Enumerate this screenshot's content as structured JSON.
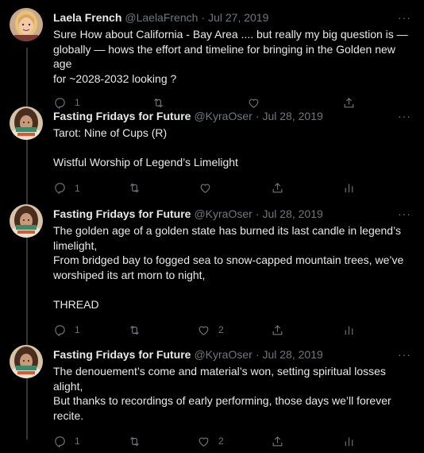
{
  "tweets": [
    {
      "name": "Laela French",
      "handle": "@LaelaFrench",
      "separator": "·",
      "date": "Jul 27, 2019",
      "text": "Sure How about California - Bay Area .... but really my big question is —\nglobally — hows the effort and timeline for bringing in the Golden new age\nfor ~2028-2032 looking ?",
      "replies": "1",
      "retweets": "",
      "likes": "",
      "show_analytics": false
    },
    {
      "name": "Fasting Fridays for Future",
      "handle": "@KyraOser",
      "separator": "·",
      "date": "Jul 28, 2019",
      "text": "Tarot: Nine of Cups (R)\n\nWistful Worship of Legend’s Limelight",
      "replies": "1",
      "retweets": "",
      "likes": "",
      "show_analytics": true
    },
    {
      "name": "Fasting Fridays for Future",
      "handle": "@KyraOser",
      "separator": "·",
      "date": "Jul 28, 2019",
      "text": "The golden age of a golden state has burned its last candle in legend’s\nlimelight,\nFrom bridged bay to fogged sea to snow-capped mountain trees, we’ve\nworshiped its art morn to night,\n\nTHREAD",
      "replies": "1",
      "retweets": "",
      "likes": "2",
      "show_analytics": true
    },
    {
      "name": "Fasting Fridays for Future",
      "handle": "@KyraOser",
      "separator": "·",
      "date": "Jul 28, 2019",
      "text": "The denouement’s come and material’s won, setting spiritual losses alight,\nBut thanks to recordings of early performing, those days we’ll forever\nrecite.",
      "replies": "1",
      "retweets": "",
      "likes": "2",
      "show_analytics": true
    }
  ],
  "more_label": "···",
  "colors": {
    "background": "#000000",
    "text": "#e7e9ea",
    "secondary": "#71767b",
    "thread_line": "#333639"
  },
  "icons": [
    "reply-icon",
    "retweet-icon",
    "like-icon",
    "share-icon",
    "analytics-icon",
    "more-icon"
  ]
}
